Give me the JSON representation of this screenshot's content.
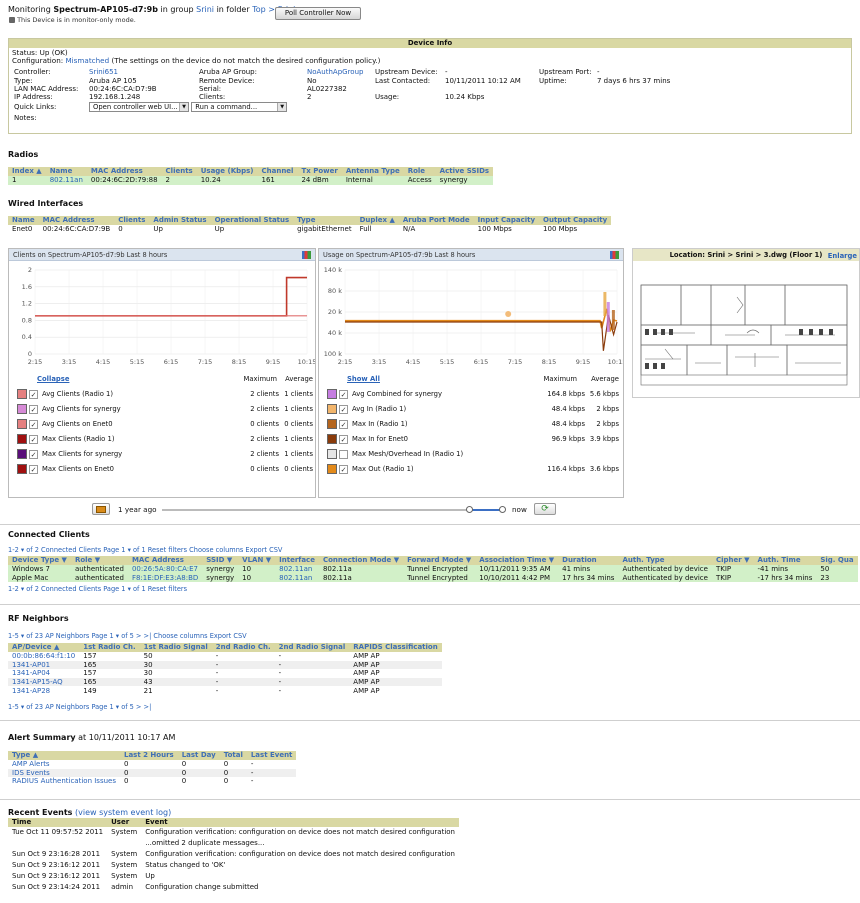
{
  "header": {
    "prefix": "Monitoring",
    "device": "Spectrum-AP105-d7:9b",
    "in_group": "in group",
    "group": "Srini",
    "in_folder": "in folder",
    "folder": "Top > Srini",
    "poll_button": "Poll Controller Now",
    "monitor_note": "This Device is in monitor-only mode."
  },
  "device_info": {
    "title": "Device Info",
    "status": "Status: Up (OK)",
    "config_label": "Configuration:",
    "config_value": "Mismatched",
    "config_note": "(The settings on the device do not match the desired configuration policy.)",
    "col1": [
      [
        "Controller:",
        "Srini651"
      ],
      [
        "Type:",
        "Aruba AP 105"
      ],
      [
        "LAN MAC Address:",
        "00:24:6C:CA:D7:9B"
      ],
      [
        "IP Address:",
        "192.168.1.248"
      ],
      [
        "Quick Links:",
        ""
      ],
      [
        "Notes:",
        ""
      ]
    ],
    "col2": [
      [
        "Aruba AP Group:",
        "NoAuthApGroup"
      ],
      [
        "Remote Device:",
        "No"
      ],
      [
        "Serial:",
        "AL0227382"
      ],
      [
        "Clients:",
        "2"
      ]
    ],
    "col3": [
      [
        "Upstream Device:",
        "-"
      ],
      [
        "Last Contacted:",
        "10/11/2011 10:12 AM"
      ],
      [
        "",
        ""
      ],
      [
        "Usage:",
        "10.24 Kbps"
      ]
    ],
    "col4": [
      [
        "Upstream Port:",
        "-"
      ],
      [
        "Uptime:",
        "7 days 6 hrs 37 mins"
      ]
    ],
    "quick_link_select": "Open controller web UI...",
    "run_command_select": "Run a command..."
  },
  "radios": {
    "title": "Radios",
    "headers": [
      "Index ▲",
      "Name",
      "MAC Address",
      "Clients",
      "Usage (Kbps)",
      "Channel",
      "Tx Power",
      "Antenna Type",
      "Role",
      "Active SSIDs"
    ],
    "rows": [
      [
        "1",
        "802.11an",
        "00:24:6C:2D:79:88",
        "2",
        "10.24",
        "161",
        "24 dBm",
        "Internal",
        "Access",
        "synergy"
      ]
    ]
  },
  "wired": {
    "title": "Wired Interfaces",
    "headers": [
      "Name",
      "MAC Address",
      "Clients",
      "Admin Status",
      "Operational Status",
      "Type",
      "Duplex ▲",
      "Aruba Port Mode",
      "Input Capacity",
      "Output Capacity"
    ],
    "rows": [
      [
        "Enet0",
        "00:24:6C:CA:D7:9B",
        "0",
        "Up",
        "Up",
        "gigabitEthernet",
        "Full",
        "N/A",
        "100 Mbps",
        "100 Mbps"
      ]
    ]
  },
  "clients_chart": {
    "title": "Clients on Spectrum-AP105-d7:9b   Last 8 hours",
    "collapse": "Collapse",
    "max_hdr": "Maximum",
    "avg_hdr": "Average",
    "legend": [
      {
        "label": "Avg Clients (Radio 1)",
        "max": "2 clients",
        "avg": "1 clients",
        "color": "#e58080",
        "checked": "✓"
      },
      {
        "label": "Avg Clients for synergy",
        "max": "2 clients",
        "avg": "1 clients",
        "color": "#d68ad6",
        "checked": "✓"
      },
      {
        "label": "Avg Clients on Enet0",
        "max": "0 clients",
        "avg": "0 clients",
        "color": "#e58080",
        "checked": "✓"
      },
      {
        "label": "Max Clients (Radio 1)",
        "max": "2 clients",
        "avg": "1 clients",
        "color": "#a01010",
        "checked": "✓"
      },
      {
        "label": "Max Clients for synergy",
        "max": "2 clients",
        "avg": "1 clients",
        "color": "#5a0f7a",
        "checked": "✓"
      },
      {
        "label": "Max Clients on Enet0",
        "max": "0 clients",
        "avg": "0 clients",
        "color": "#a01010",
        "checked": "✓"
      }
    ]
  },
  "usage_chart": {
    "title": "Usage on Spectrum-AP105-d7:9b   Last 8 hours",
    "show_all": "Show All",
    "max_hdr": "Maximum",
    "avg_hdr": "Average",
    "legend": [
      {
        "label": "Avg Combined for synergy",
        "max": "164.8 kbps",
        "avg": "5.6 kbps",
        "color": "#c57de0",
        "checked": "✓"
      },
      {
        "label": "Avg In (Radio 1)",
        "max": "48.4 kbps",
        "avg": "2 kbps",
        "color": "#f2b56b",
        "checked": "✓"
      },
      {
        "label": "Max In (Radio 1)",
        "max": "48.4 kbps",
        "avg": "2 kbps",
        "color": "#b5651d",
        "checked": "✓"
      },
      {
        "label": "Max In for Enet0",
        "max": "96.9 kbps",
        "avg": "3.9 kbps",
        "color": "#8a3b0b",
        "checked": "✓"
      },
      {
        "label": "Max Mesh/Overhead In (Radio 1)",
        "max": "",
        "avg": "",
        "color": "#e6e6e6",
        "checked": ""
      },
      {
        "label": "Max Out (Radio 1)",
        "max": "116.4 kbps",
        "avg": "3.6 kbps",
        "color": "#e38a1a",
        "checked": "✓"
      }
    ]
  },
  "chart_data": [
    {
      "type": "line",
      "title": "Clients on Spectrum-AP105-d7:9b   Last 8 hours",
      "x": [
        "2:15",
        "3:15",
        "4:15",
        "5:15",
        "6:15",
        "7:15",
        "8:15",
        "9:15",
        "10:15"
      ],
      "yticks": [
        "2",
        "1.6",
        "1.2",
        "0.8",
        "0.4",
        "0"
      ],
      "ylim": [
        0,
        2.2
      ],
      "series": [
        {
          "name": "Max Clients (Radio 1)",
          "points": [
            [
              0,
              1
            ],
            [
              7.4,
              1
            ],
            [
              7.4,
              2
            ],
            [
              8,
              2
            ]
          ]
        },
        {
          "name": "Avg Clients (Radio 1)",
          "points": [
            [
              0,
              1
            ],
            [
              8,
              1
            ]
          ]
        }
      ]
    },
    {
      "type": "line",
      "title": "Usage on Spectrum-AP105-d7:9b   Last 8 hours",
      "x": [
        "2:15",
        "3:15",
        "4:15",
        "5:15",
        "6:15",
        "7:15",
        "8:15",
        "9:15",
        "10:15"
      ],
      "yticks": [
        "140 k",
        "80 k",
        "20 k",
        "40 k",
        "100 k"
      ],
      "ylim": [
        -100,
        160
      ],
      "series": [
        {
          "name": "Max Out (Radio 1)",
          "points": [
            [
              0,
              3
            ],
            [
              7.5,
              3
            ],
            [
              7.55,
              -20
            ],
            [
              7.7,
              40
            ],
            [
              7.8,
              -30
            ],
            [
              7.9,
              5
            ],
            [
              8,
              2
            ]
          ]
        },
        {
          "name": "Max In for Enet0",
          "points": [
            [
              0,
              -1
            ],
            [
              7.55,
              -1
            ],
            [
              7.6,
              -90
            ],
            [
              7.75,
              20
            ],
            [
              7.9,
              -40
            ],
            [
              8,
              -1
            ]
          ]
        }
      ]
    }
  ],
  "timeline": {
    "start": "1 year ago",
    "end": "now"
  },
  "map": {
    "title": "Location: Srini > Srini > 3.dwg (Floor 1)",
    "enlarge": "Enlarge"
  },
  "connected": {
    "title": "Connected Clients",
    "pager": "1-2 ▾ of 2 Connected Clients  Page 1 ▾ of 1",
    "reset": "Reset filters",
    "choose": "Choose columns",
    "export": "Export CSV",
    "headers": [
      "Device Type ▼",
      "Role ▼",
      "MAC Address",
      "SSID ▼",
      "VLAN ▼",
      "Interface",
      "Connection Mode ▼",
      "Forward Mode ▼",
      "Association Time ▼",
      "Duration",
      "Auth. Type",
      "Cipher ▼",
      "Auth. Time",
      "Sig. Qua"
    ],
    "rows": [
      [
        "Windows 7",
        "authenticated",
        "00:26:5A:80:CA:E7",
        "synergy",
        "10",
        "802.11an",
        "802.11a",
        "Tunnel Encrypted",
        "10/11/2011 9:35 AM",
        "41 mins",
        "Authenticated by device",
        "TKIP",
        "-41 mins",
        "50"
      ],
      [
        "Apple Mac",
        "authenticated",
        "F8:1E:DF:E3:A8:BD",
        "synergy",
        "10",
        "802.11an",
        "802.11a",
        "Tunnel Encrypted",
        "10/10/2011 4:42 PM",
        "17 hrs 34 mins",
        "Authenticated by device",
        "TKIP",
        "-17 hrs 34 mins",
        "23"
      ]
    ],
    "pager2": "1-2 ▾ of 2 Connected Clients  Page 1 ▾ of 1"
  },
  "rf": {
    "title": "RF Neighbors",
    "pager": "1-5 ▾ of 23 AP Neighbors  Page 1 ▾ of 5  >  >|",
    "choose": "Choose columns",
    "export": "Export CSV",
    "headers": [
      "AP/Device ▲",
      "1st Radio Ch.",
      "1st Radio Signal",
      "2nd Radio Ch.",
      "2nd Radio Signal",
      "RAPIDS Classification"
    ],
    "rows": [
      [
        "00:0b:86:64:f1:10",
        "157",
        "50",
        "-",
        "-",
        "AMP AP"
      ],
      [
        "1341-AP01",
        "165",
        "30",
        "-",
        "-",
        "AMP AP"
      ],
      [
        "1341-AP04",
        "157",
        "30",
        "-",
        "-",
        "AMP AP"
      ],
      [
        "1341-AP15-AQ",
        "165",
        "43",
        "-",
        "-",
        "AMP AP"
      ],
      [
        "1341-AP28",
        "149",
        "21",
        "-",
        "-",
        "AMP AP"
      ]
    ],
    "pager2": "1-5 ▾ of 23 AP Neighbors  Page 1 ▾ of 5  >  >|"
  },
  "alerts": {
    "title": "Alert Summary",
    "at": "at 10/11/2011 10:17 AM",
    "headers": [
      "Type ▲",
      "Last 2 Hours",
      "Last Day",
      "Total",
      "Last Event"
    ],
    "rows": [
      [
        "AMP Alerts",
        "0",
        "0",
        "0",
        "-"
      ],
      [
        "IDS Events",
        "0",
        "0",
        "0",
        "-"
      ],
      [
        "RADIUS Authentication Issues",
        "0",
        "0",
        "0",
        "-"
      ]
    ]
  },
  "events": {
    "title": "Recent Events",
    "link": "(view system event log)",
    "headers": [
      "Time",
      "User",
      "Event"
    ],
    "rows": [
      [
        "Tue Oct 11 09:57:52 2011",
        "System",
        "Configuration verification: configuration on device does not match desired configuration"
      ],
      [
        "",
        "",
        "...omitted 2 duplicate messages..."
      ],
      [
        "Sun Oct 9 23:16:28 2011",
        "System",
        "Configuration verification: configuration on device does not match desired configuration"
      ],
      [
        "Sun Oct 9 23:16:12 2011",
        "System",
        "Status changed to 'OK'"
      ],
      [
        "Sun Oct 9 23:16:12 2011",
        "System",
        "Up"
      ],
      [
        "Sun Oct 9 23:14:24 2011",
        "admin",
        "Configuration change submitted"
      ]
    ]
  }
}
